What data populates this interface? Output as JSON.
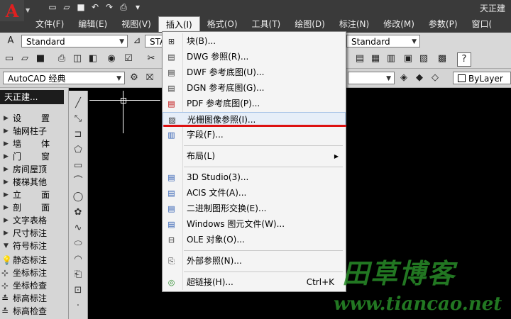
{
  "app": {
    "title": "天正建"
  },
  "menubar": [
    {
      "label": "文件(F)"
    },
    {
      "label": "编辑(E)"
    },
    {
      "label": "视图(V)"
    },
    {
      "label": "插入(I)",
      "active": true
    },
    {
      "label": "格式(O)"
    },
    {
      "label": "工具(T)"
    },
    {
      "label": "绘图(D)"
    },
    {
      "label": "标注(N)"
    },
    {
      "label": "修改(M)"
    },
    {
      "label": "参数(P)"
    },
    {
      "label": "窗口("
    }
  ],
  "toolbar": {
    "text_style": "Standard",
    "dim_style": "STAN",
    "table_style": "Standard",
    "workspace": "AutoCAD 经典",
    "layer": "ByLayer"
  },
  "left_panel": {
    "title": "天正建...",
    "items": [
      {
        "label": "设　置",
        "type": "group"
      },
      {
        "label": "轴网柱子",
        "type": "group"
      },
      {
        "label": "墙　体",
        "type": "group"
      },
      {
        "label": "门　窗",
        "type": "group"
      },
      {
        "label": "房间屋顶",
        "type": "group"
      },
      {
        "label": "楼梯其他",
        "type": "group"
      },
      {
        "label": "立　面",
        "type": "group"
      },
      {
        "label": "剖　面",
        "type": "group"
      },
      {
        "label": "文字表格",
        "type": "group"
      },
      {
        "label": "尺寸标注",
        "type": "group"
      },
      {
        "label": "符号标注",
        "type": "group-open"
      },
      {
        "label": "静态标注",
        "type": "cmd"
      },
      {
        "label": "坐标标注",
        "type": "cmd"
      },
      {
        "label": "坐标检查",
        "type": "cmd"
      },
      {
        "label": "标高标注",
        "type": "cmd"
      },
      {
        "label": "标高检查",
        "type": "cmd"
      }
    ]
  },
  "insert_menu": {
    "items": [
      {
        "label": "块(B)...",
        "icon": "block-icon"
      },
      {
        "label": "DWG 参照(R)...",
        "icon": "dwg-icon"
      },
      {
        "label": "DWF 参考底图(U)...",
        "icon": "dwf-icon"
      },
      {
        "label": "DGN 参考底图(G)...",
        "icon": "dgn-icon"
      },
      {
        "label": "PDF 参考底图(P)...",
        "icon": "pdf-icon"
      },
      {
        "label": "光栅图像参照(I)...",
        "icon": "raster-image-icon",
        "highlighted": true
      },
      {
        "label": "字段(F)...",
        "icon": "field-icon"
      },
      {
        "label": "布局(L)",
        "icon": "",
        "submenu": true
      },
      {
        "label": "3D Studio(3)...",
        "icon": "3ds-icon"
      },
      {
        "label": "ACIS 文件(A)...",
        "icon": "acis-icon"
      },
      {
        "label": "二进制图形交换(E)...",
        "icon": "dxb-icon"
      },
      {
        "label": "Windows 图元文件(W)...",
        "icon": "wmf-icon"
      },
      {
        "label": "OLE 对象(O)...",
        "icon": "ole-icon"
      },
      {
        "label": "外部参照(N)...",
        "icon": "xref-icon"
      },
      {
        "label": "超链接(H)...",
        "icon": "hyperlink-icon",
        "shortcut": "Ctrl+K"
      }
    ]
  },
  "watermark": {
    "line1": "田草博客",
    "line2": "www.tiancao.net"
  }
}
